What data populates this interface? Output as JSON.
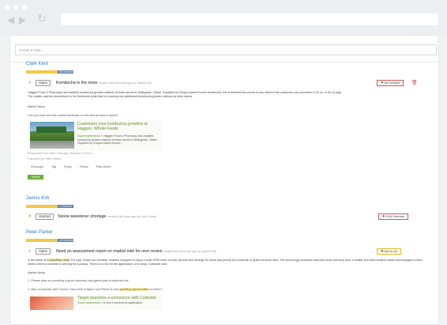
{
  "browser": {
    "back_icon": "chevron-left-icon",
    "forward_icon": "chevron-right-icon",
    "reload_icon": "reload-icon"
  },
  "task_input": {
    "placeholder": "Create a Task..."
  },
  "groups": [
    {
      "person": "Clark Kent",
      "overdue_label": "68 Overdue",
      "task": {
        "status": "Open",
        "title": "Kombucha in the news",
        "meta": "created few seconds ago by James Kirk",
        "due": "68 Overdue"
      },
      "description": "Haggen Food & Pharmacy has installed kombucha growler stations at three stores in Bellingham, Wash. Supplied by Oregon-based Humm Kombucha, the fermented tea comes in four flavors that customers can purchase in 32 oz, or 64 oz jugs.",
      "description2": "The retailer said its commitment to its Northwest pride that it is locking new additional kombucha growler stations at other stores.",
      "market_news_label": "Market News",
      "request": "Can you look into this market feedback on this and provide a report?",
      "card": {
        "title": "Customers your kombucha growlers at Haggen, Whole Foods",
        "source": "Supermarketnews",
        "text": "» Haggen Food & Pharmacy has installed kombucha growler stations at three stores in Bellingham, Wash. Supplied by Oregon-based humm..."
      },
      "requested_due": "Requested Due Date Tuesday, October 07 2014",
      "followed_by": "Followed by Peter Parker",
      "actions": [
        "Reassign",
        "Tag",
        "Reply",
        "Follow",
        "Risk Metric"
      ],
      "green_button": "Submit"
    },
    {
      "person": "James Kirk",
      "overdue_label": "1 Overdue",
      "task": {
        "status": "Started",
        "title": "Stevia sweetener shortage",
        "meta": "created 384 days ago by John Carter",
        "due": "1116 Overdue"
      }
    },
    {
      "person": "Peter Parker",
      "overdue_label": "10 Overdue",
      "task": {
        "status": "Open",
        "title": "Need an assessment report on market intel for next review",
        "meta": "created few seconds ago by James Kirk",
        "due": "Due in 2d"
      },
      "description_prefix": "In the wake of",
      "description_hl": "Competition news",
      "description_rest": " The app, known as Curbside, enables shoppers to shop a local GPW store on their phones and arrange for same-day pickup at a curbside or guest services area. The technology accesses real-time local inventory from a retailer and uses location-based technologies to alert stores when a customer is arriving for a pickup. There is no fee for the application, or to shop, Curbside said.",
      "market_news_label": "Market News",
      "point1": "1. Please plan on providing a quick summary and game plan to address this",
      "point2_prefix": "2. Also coordinate with Cosmo Corp team to figure out if there is any",
      "point2_hl": "upselling opportunities",
      "point2_suffix": " for them?",
      "card": {
        "title": "Target launches e-commerce with Curbside",
        "source": "Supermarketnews",
        "text": "» A new e-commerce application"
      }
    }
  ],
  "colors": {
    "accent": "#2f7bbf",
    "overdue_yellow": "#f6c745",
    "overdue_blue": "#5b7fae",
    "danger": "#d9534f"
  }
}
